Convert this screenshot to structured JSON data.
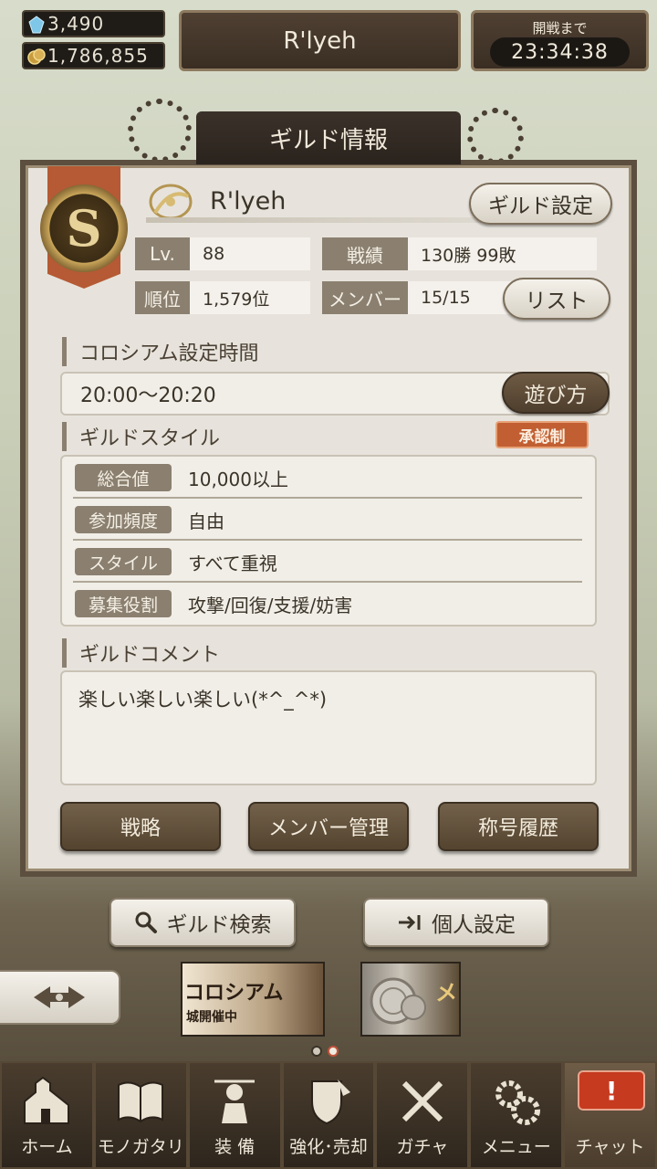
{
  "top_bar": {
    "gems": "3,490",
    "gold": "1,786,855",
    "title": "R'lyeh",
    "timer_label": "開戦まで",
    "timer_value": "23:34:38"
  },
  "panel": {
    "header": "ギルド情報",
    "emblem_letter": "S",
    "guild_name": "R'lyeh",
    "guild_settings_button": "ギルド設定",
    "stats": {
      "level_label": "Lv.",
      "level_value": "88",
      "record_label": "戦績",
      "record_value": "130勝  99敗",
      "rank_label": "順位",
      "rank_value": "1,579位",
      "members_label": "メンバー",
      "members_value": "15/15"
    },
    "list_button": "リスト",
    "colosseum_title": "コロシアム設定時間",
    "colosseum_time": "20:00〜20:20",
    "how_to_play_button": "遊び方",
    "style_title": "ギルドスタイル",
    "approval_badge": "承認制",
    "style_rows": [
      {
        "label": "総合値",
        "value": "10,000以上"
      },
      {
        "label": "参加頻度",
        "value": "自由"
      },
      {
        "label": "スタイル",
        "value": "すべて重視"
      },
      {
        "label": "募集役割",
        "value": "攻撃/回復/支援/妨害"
      }
    ],
    "comment_title": "ギルドコメント",
    "comment_text": "楽しい楽しい楽しい(*^_^*)",
    "actions": [
      "戦略",
      "メンバー管理",
      "称号履歴"
    ]
  },
  "lower": {
    "guild_search_button": "ギルド検索",
    "personal_settings_button": "個人設定",
    "banner1_text": "コロシアム",
    "banner1_sub": "城開催中",
    "banner2_text": "メ",
    "carousel_active_index": 2
  },
  "nav": {
    "items": [
      {
        "label": "ホーム",
        "icon": "home-icon"
      },
      {
        "label": "モノガタリ",
        "icon": "book-icon"
      },
      {
        "label": "装 備",
        "icon": "equipment-icon"
      },
      {
        "label": "強化･売却",
        "icon": "enhance-icon"
      },
      {
        "label": "ガチャ",
        "icon": "gacha-icon"
      },
      {
        "label": "メニュー",
        "icon": "gear-icon"
      },
      {
        "label": "チャット",
        "icon": "chat-icon"
      }
    ],
    "chat_alert": "!"
  },
  "colors": {
    "panel_bg": "#e7e3dc",
    "label_bg": "#8b8070",
    "button_dark": "#5f4e3a",
    "badge": "#c15f32"
  }
}
